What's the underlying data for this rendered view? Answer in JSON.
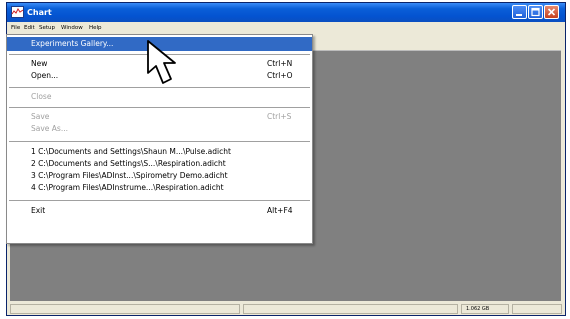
{
  "window": {
    "title": "Chart"
  },
  "menubar": [
    "File",
    "Edit",
    "Setup",
    "Window",
    "Help"
  ],
  "file_menu": {
    "experiments_gallery": "Experiments Gallery...",
    "new_label": "New",
    "new_shortcut": "Ctrl+N",
    "open_label": "Open...",
    "open_shortcut": "Ctrl+O",
    "close_label": "Close",
    "save_label": "Save",
    "save_shortcut": "Ctrl+S",
    "save_as_label": "Save As...",
    "recent": [
      "1 C:\\Documents and Settings\\Shaun M...\\Pulse.adicht",
      "2 C:\\Documents and Settings\\S...\\Respiration.adicht",
      "3 C:\\Program Files\\ADInst...\\Spirometry Demo.adicht",
      "4 C:\\Program Files\\ADInstrume...\\Respiration.adicht"
    ],
    "exit_label": "Exit",
    "exit_shortcut": "Alt+F4"
  },
  "statusbar": {
    "disk_space": "1.062 GB"
  },
  "colors": {
    "highlight": "#316ac5",
    "titlebar": "#0453d0",
    "client": "#808080"
  },
  "icons": [
    "app-icon",
    "minimize-icon",
    "maximize-icon",
    "close-icon",
    "mouse-pointer-icon"
  ]
}
